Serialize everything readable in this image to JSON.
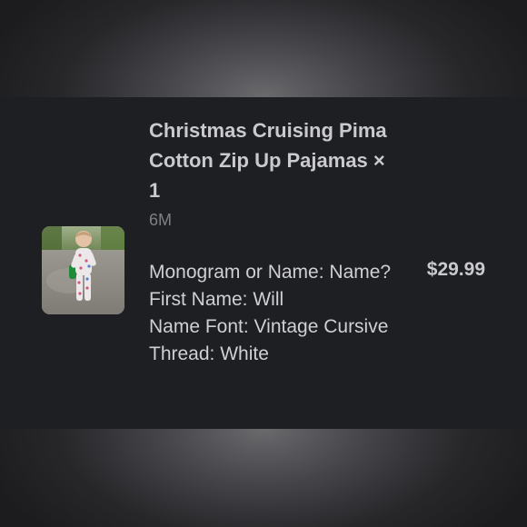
{
  "order_item": {
    "title": "Christmas Cruising Pima Cotton Zip Up Pajamas × 1",
    "variant": "6M",
    "properties": [
      "Monogram or Name: Name?",
      "First Name: Will",
      "Name Font: Vintage Cursive",
      "Thread: White"
    ],
    "price": "$29.99",
    "thumbnail_icon": "product-photo-child-in-pajamas"
  },
  "colors": {
    "card_background": "#1e1f22",
    "title_text": "#c9c9ce",
    "muted_text": "#7f7f85"
  }
}
